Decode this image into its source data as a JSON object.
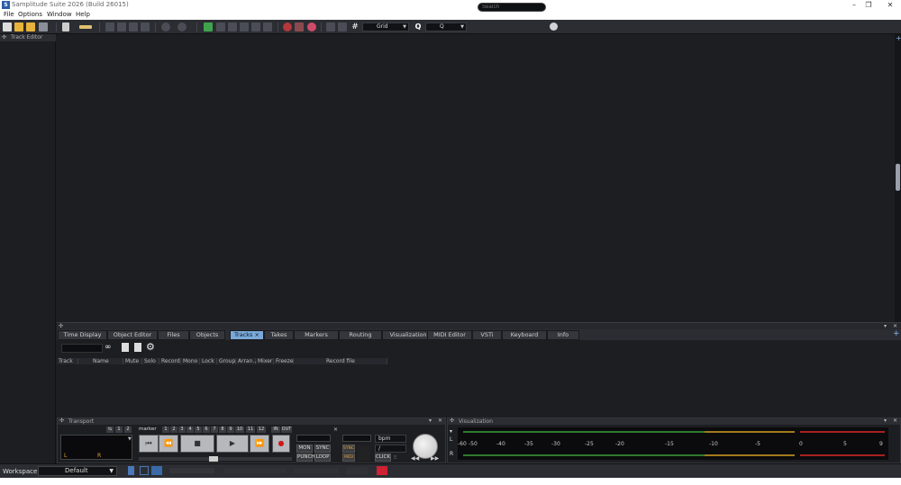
{
  "app": {
    "title": "Samplitude Suite 2026 (Build 26015)",
    "logo": "S",
    "min": "–",
    "restore": "❐",
    "close": "✕"
  },
  "menu": [
    "File",
    "Options",
    "Window",
    "Help"
  ],
  "toolbar": {
    "grid_label": "Grid",
    "q_label": "Q",
    "search_placeholder": "Search",
    "grid_icon": "#",
    "q_icon": "Q"
  },
  "left_panel": {
    "title": "Track Editor"
  },
  "dock": {
    "tabs": [
      "Time Display",
      "Object Editor",
      "Files",
      "Objects",
      "Tracks",
      "Takes",
      "Markers",
      "Routing",
      "Visualization",
      "MIDI Editor",
      "VSTi",
      "Keyboard",
      "Info"
    ],
    "active_tab": "Tracks",
    "tab_close": "×"
  },
  "tracks": {
    "columns": [
      "Track",
      "Name",
      "Mute",
      "Solo",
      "Record",
      "Mono",
      "Lock",
      "Group",
      "Arran...",
      "Mixer",
      "Freeze",
      "Record file"
    ]
  },
  "transport": {
    "title": "Transport",
    "marker_label": "marker",
    "markers": [
      "1",
      "2",
      "3",
      "4",
      "5",
      "6",
      "7",
      "8",
      "9",
      "10",
      "11",
      "12"
    ],
    "in_label": "IN",
    "out_label": "OUT",
    "left_nums": [
      "1",
      "2"
    ],
    "mon": "MON",
    "sync": "SYNC",
    "punch": "PUNCH",
    "loop": "LOOP",
    "sync2": "SYNC",
    "midi": "MIDI",
    "bpm_label": "bpm",
    "slash": "/",
    "click": "CLICK",
    "lr_l": "L",
    "lr_r": "R"
  },
  "visualization": {
    "title": "Visualization",
    "scale": [
      "-60",
      "-50",
      "-40",
      "-35",
      "-30",
      "-25",
      "-20",
      "-15",
      "-10",
      "-5",
      "0",
      "5",
      "9"
    ],
    "channels": [
      "L",
      "R"
    ]
  },
  "workspace": {
    "label": "Workspace:",
    "value": "Default"
  }
}
